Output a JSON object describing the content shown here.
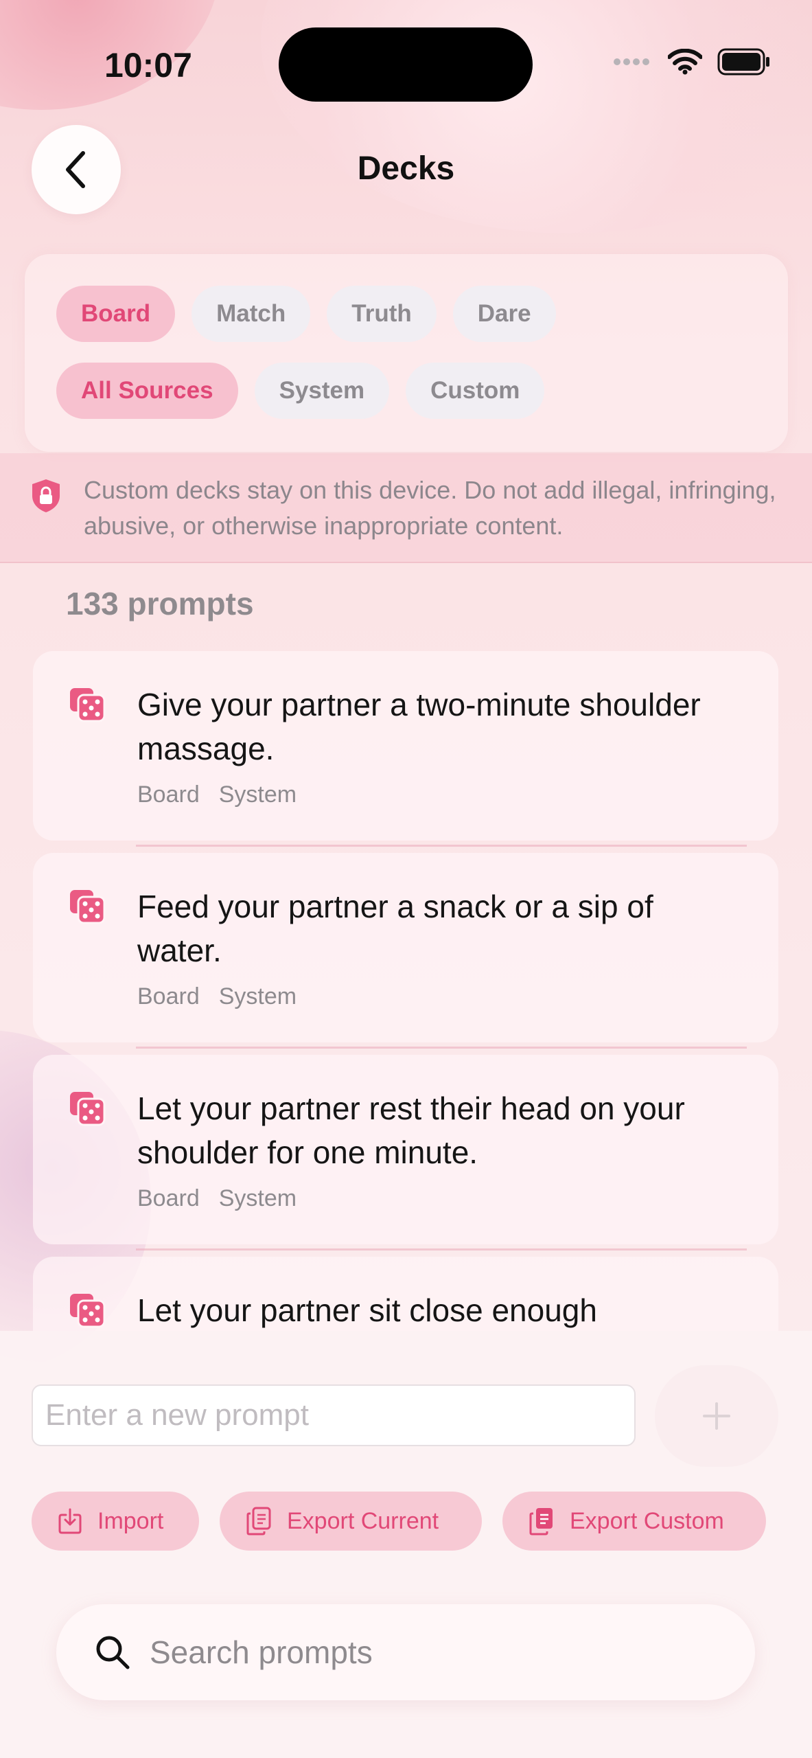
{
  "status_bar": {
    "time": "10:07"
  },
  "header": {
    "title": "Decks"
  },
  "filters": {
    "types": [
      {
        "label": "Board",
        "active": true
      },
      {
        "label": "Match",
        "active": false
      },
      {
        "label": "Truth",
        "active": false
      },
      {
        "label": "Dare",
        "active": false
      }
    ],
    "sources": [
      {
        "label": "All Sources",
        "active": true
      },
      {
        "label": "System",
        "active": false
      },
      {
        "label": "Custom",
        "active": false
      }
    ]
  },
  "notice": {
    "text": "Custom decks stay on this device. Do not add illegal, infringing, abusive, or otherwise inappropriate content."
  },
  "prompt_count": "133 prompts",
  "prompts": [
    {
      "text": "Give your partner a two-minute shoulder massage.",
      "tags": [
        "Board",
        "System"
      ]
    },
    {
      "text": "Feed your partner a snack or a sip of water.",
      "tags": [
        "Board",
        "System"
      ]
    },
    {
      "text": "Let your partner rest their head on your shoulder for one minute.",
      "tags": [
        "Board",
        "System"
      ]
    },
    {
      "text": "Let your partner sit close enough",
      "tags": []
    }
  ],
  "composer": {
    "placeholder": "Enter a new prompt"
  },
  "actions": {
    "import": "Import",
    "export_current": "Export Current",
    "export_custom": "Export Custom"
  },
  "search": {
    "placeholder": "Search prompts"
  },
  "colors": {
    "accent": "#e14877",
    "chip_active_bg": "#f7c1cf"
  }
}
